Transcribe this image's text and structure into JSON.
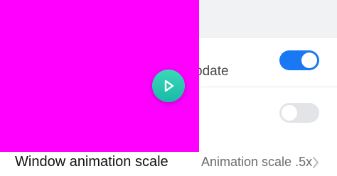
{
  "settings": {
    "row1_label": "pdate",
    "row1_toggle_on": true,
    "row2_toggle_on": false,
    "animation_row": {
      "title": "Window animation scale",
      "value": "Animation scale .5x"
    }
  },
  "video_overlay": {
    "background_color": "#ff00ff",
    "play_icon": "play-icon"
  },
  "colors": {
    "toggle_on": "#1a78f2",
    "toggle_off": "#e3e4e7",
    "play_button": "#22c4ae"
  }
}
